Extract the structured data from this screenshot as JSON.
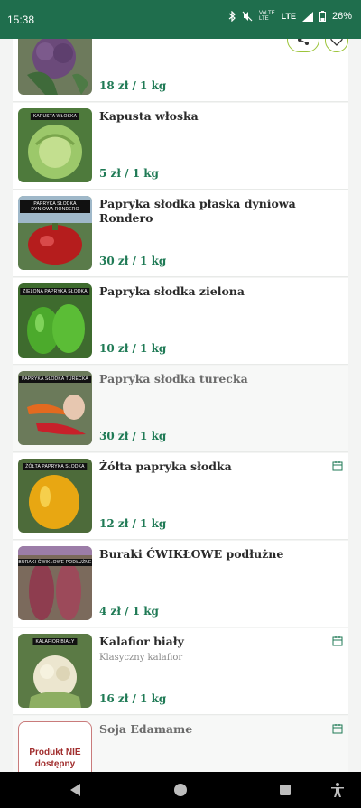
{
  "status_bar": {
    "time": "15:38",
    "signal_label_top": "VoLTE",
    "signal_label_bottom": "LTE",
    "network": "LTE",
    "battery": "26%"
  },
  "products": [
    {
      "name": "",
      "price": "18 zł / 1 kg",
      "tag": "",
      "image": "broccoli"
    },
    {
      "name": "Kapusta włoska",
      "price": "5 zł / 1 kg",
      "tag": "KAPUSTA WŁOSKA",
      "image": "cabbage"
    },
    {
      "name": "Papryka słodka płaska dyniowa Rondero",
      "price": "30 zł / 1 kg",
      "tag": "PAPRYKA SŁODKA DYNIOWA RONDERO",
      "image": "red-pepper"
    },
    {
      "name": "Papryka słodka zielona",
      "price": "10 zł / 1 kg",
      "tag": "ZIELONA PAPRYKA SŁODKA",
      "image": "green-pepper"
    },
    {
      "name": "Papryka słodka turecka",
      "price": "30 zł / 1 kg",
      "tag": "PAPRYKA SŁODKA TURECKA",
      "image": "turkish-pepper"
    },
    {
      "name": "Żółta papryka słodka",
      "price": "12 zł / 1 kg",
      "tag": "ŻÓŁTA PAPRYKA SŁODKA",
      "image": "yellow-pepper"
    },
    {
      "name": "Buraki ĆWIKŁOWE podłużne",
      "price": "4 zł / 1 kg",
      "tag": "BURAKI ĆWIKŁOWE PODŁUŻNE",
      "image": "beets"
    },
    {
      "name": "Kalafior biały",
      "description": "Klasyczny kalafior",
      "price": "16 zł / 1 kg",
      "tag": "KALAFIOR BIAŁY",
      "image": "cauliflower"
    },
    {
      "name": "Soja Edamame",
      "unavailable_label": "Produkt NIE dostępny"
    }
  ],
  "colors": {
    "header_green": "#1f6e4d",
    "price_green": "#1f7a55",
    "button_outline": "#9cc43a",
    "unavailable_red": "#a12e2e"
  },
  "icons": [
    "bluetooth-icon",
    "mute-icon",
    "signal-icon",
    "battery-icon",
    "share-icon",
    "heart-icon",
    "calendar-icon",
    "back-icon",
    "home-icon",
    "recents-icon",
    "accessibility-icon"
  ]
}
